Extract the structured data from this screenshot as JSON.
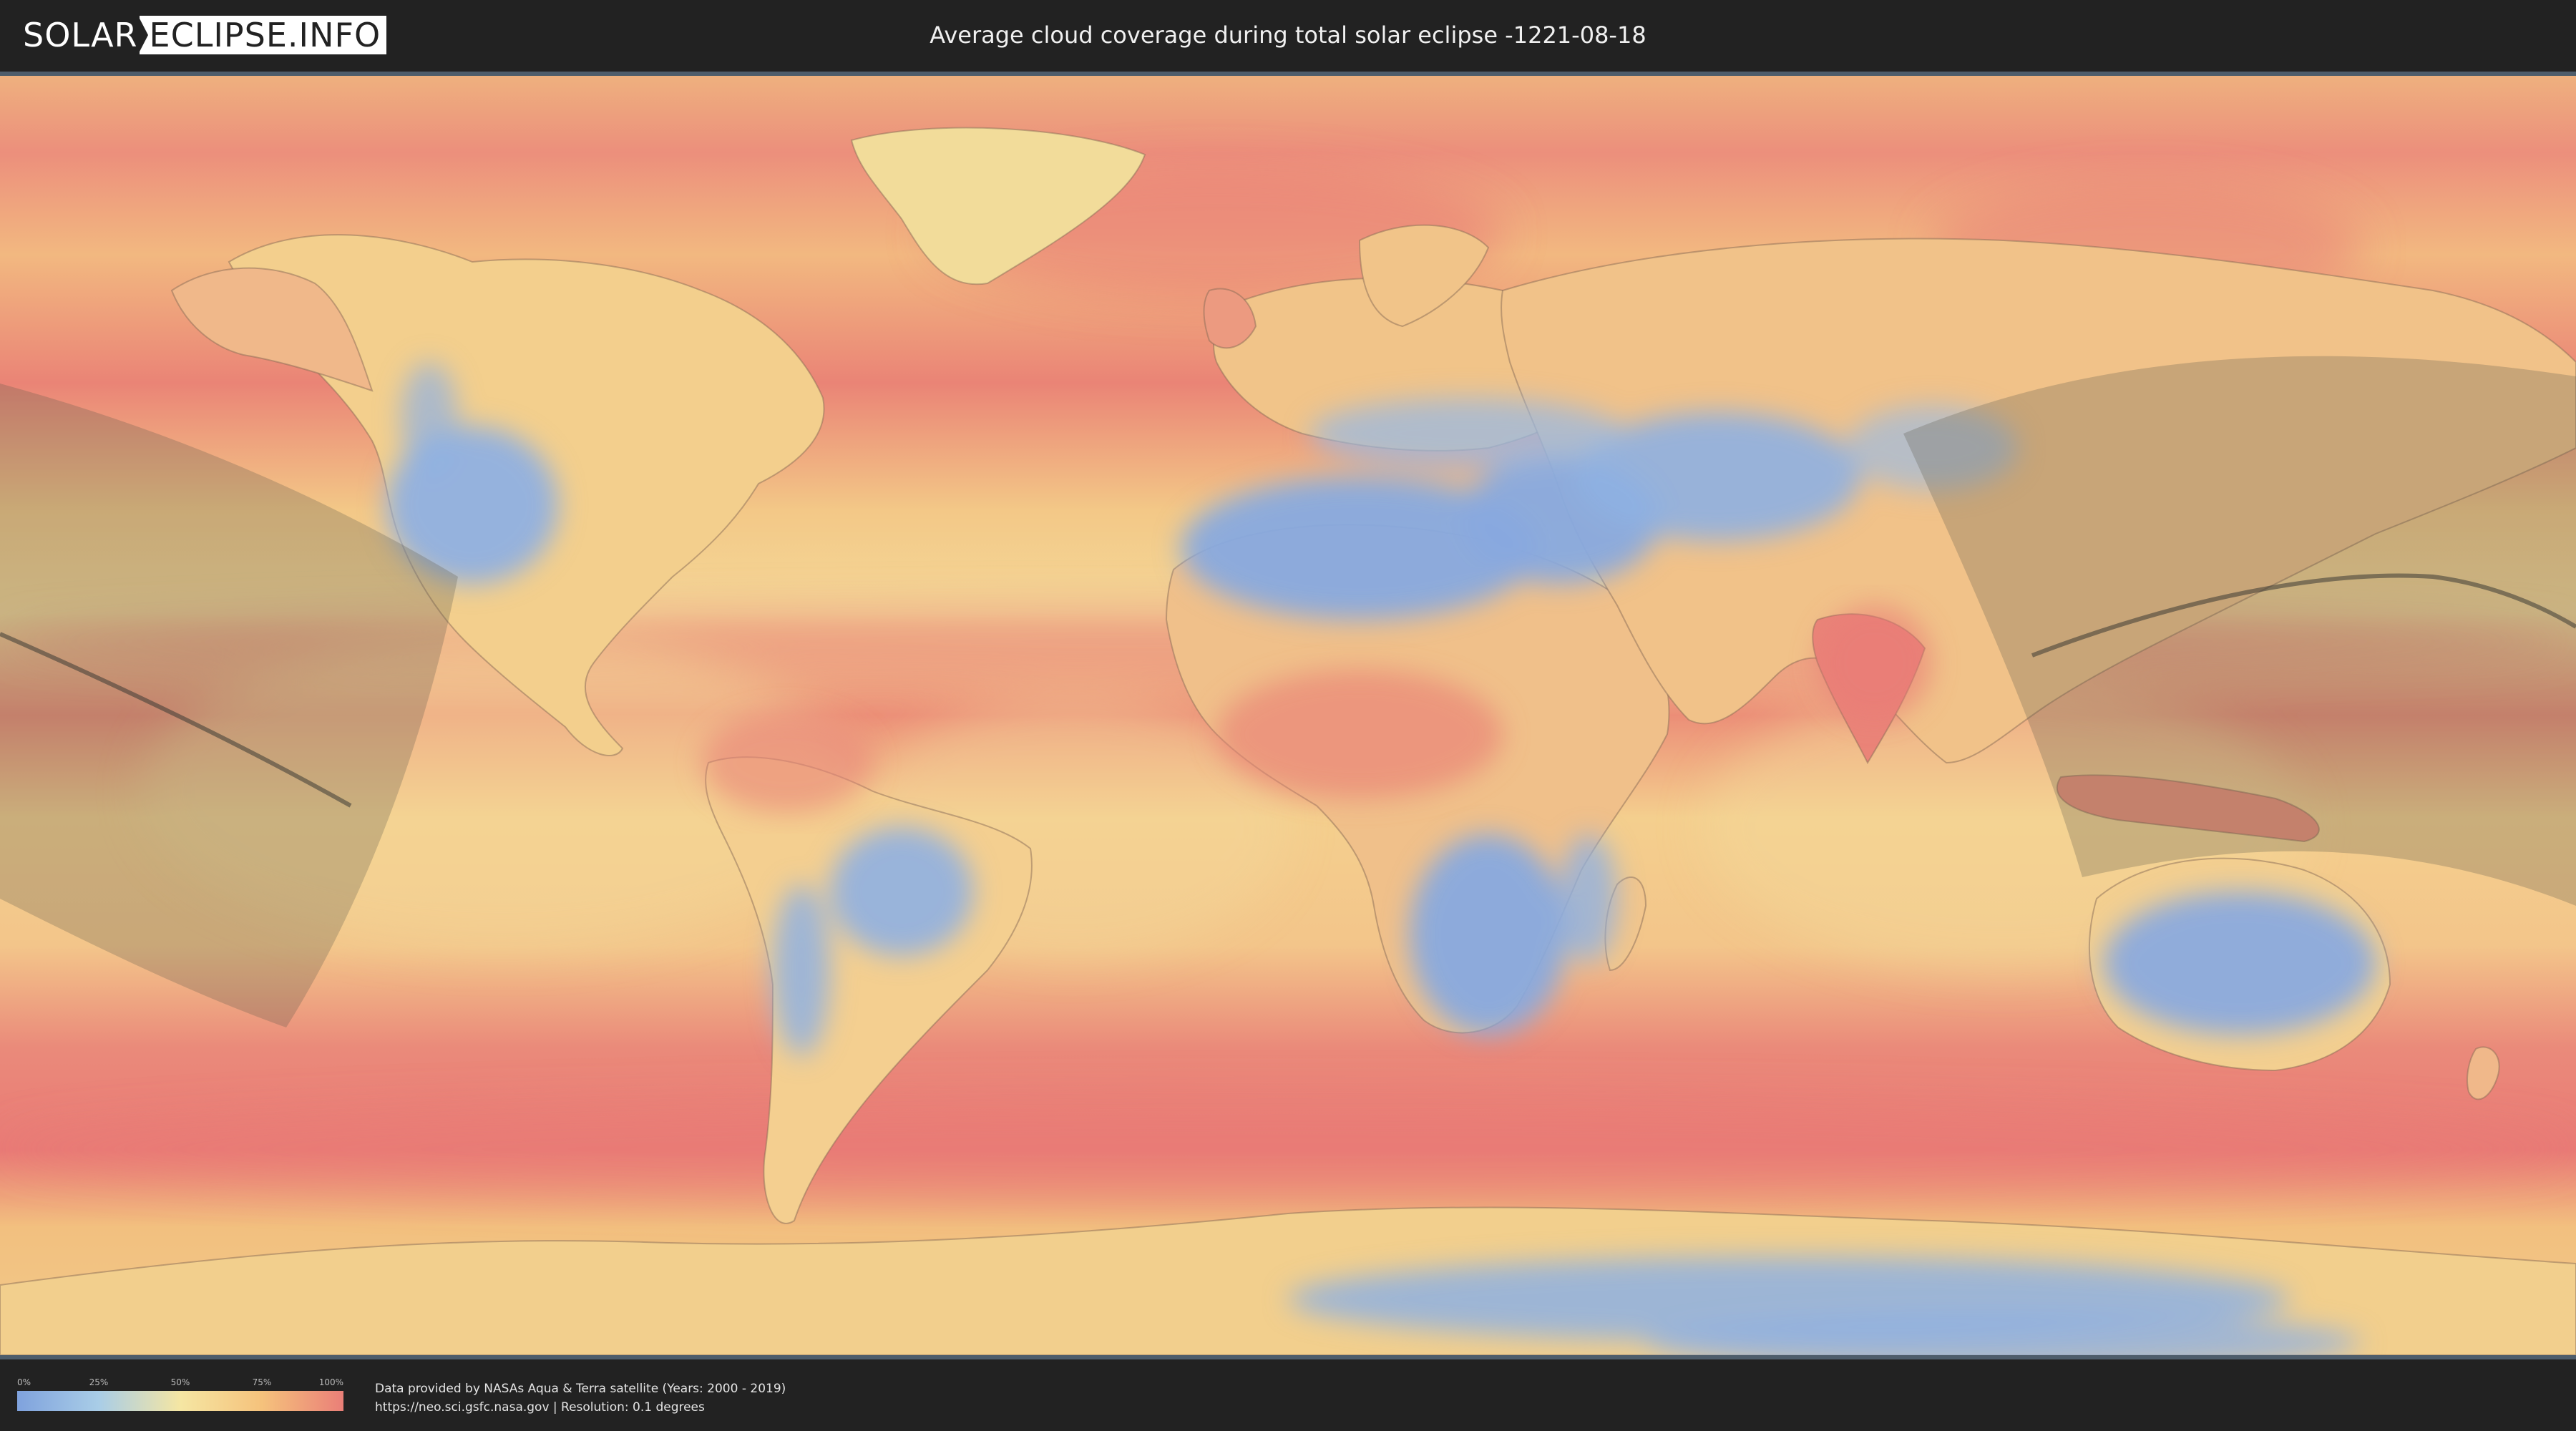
{
  "header": {
    "logo": {
      "part1": "SOLAR",
      "part2": "ECLIPSE.INFO"
    },
    "title": "Average cloud coverage during total solar eclipse -1221-08-18"
  },
  "map": {
    "colors": {
      "low": "#7fa2dd",
      "low_mid": "#a9cde7",
      "mid": "#f5e6a3",
      "mid_high": "#f5c27c",
      "high": "#ea7f78",
      "coastline": "#8a6b55",
      "eclipse_band": "#5e5a4d",
      "central_line": "#3d3a35"
    }
  },
  "legend": {
    "ticks": [
      "0%",
      "25%",
      "50%",
      "75%",
      "100%"
    ]
  },
  "footer": {
    "credit_line1": "Data provided by NASAs Aqua & Terra satellite (Years: 2000 - 2019)",
    "credit_line2": "https://neo.sci.gsfc.nasa.gov | Resolution: 0.1 degrees"
  }
}
